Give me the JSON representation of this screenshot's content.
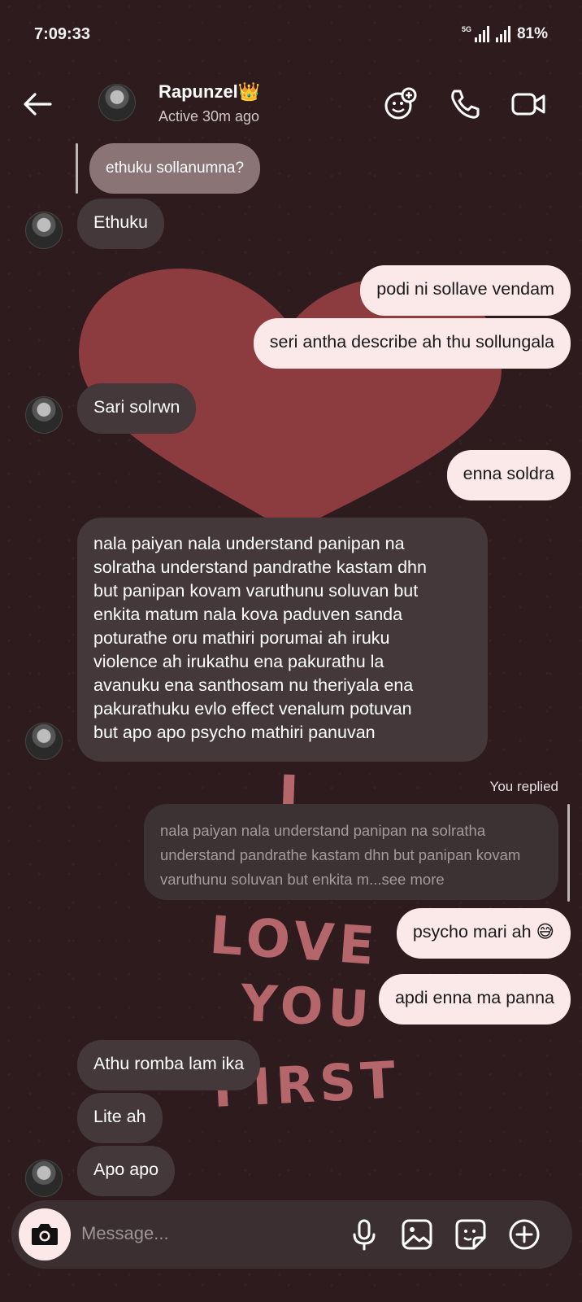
{
  "status_bar": {
    "time": "7:09:33",
    "network": "5G",
    "battery": "81%"
  },
  "header": {
    "contact_name": "Rapunzel👑",
    "activity": "Active 30m ago"
  },
  "messages": {
    "quoted_reply": "ethuku sollanumna?",
    "m1": "Ethuku",
    "m2": "podi ni sollave vendam",
    "m3": "seri antha describe ah thu sollungala",
    "m4": "Sari solrwn",
    "m5": "enna soldra",
    "m6_lines": [
      "nala paiyan nala understand panipan na",
      "solratha understand pandrathe kastam dhn",
      "but panipan kovam varuthunu soluvan but",
      "enkita matum nala kova paduven sanda",
      "poturathe oru mathiri porumai ah iruku",
      "violence ah irukathu ena pakurathu la",
      "avanuku ena santhosam nu theriyala ena",
      "pakurathuku evlo effect venalum potuvan",
      "but apo apo psycho mathiri panuvan"
    ],
    "replied_label": "You replied",
    "quoted_text": "nala paiyan nala understand panipan na solratha understand pandrathe kastam dhn but panipan kovam varuthunu soluvan but enkita m...see more",
    "m7": "psycho mari ah 😅",
    "m8": "apdi enna ma panna",
    "m9": "Athu romba lam ika",
    "m10": "Lite ah",
    "m11": "Apo apo"
  },
  "background_art": {
    "line1": "I",
    "line2": "LOVE",
    "line3": "YOU",
    "line4": "FIRST"
  },
  "composer": {
    "placeholder": "Message..."
  },
  "colors": {
    "outgoing_bubble": "#fbe8e9",
    "incoming_bubble": "#45383a",
    "heart": "#8c3b3e",
    "background": "#2e1b1e"
  }
}
